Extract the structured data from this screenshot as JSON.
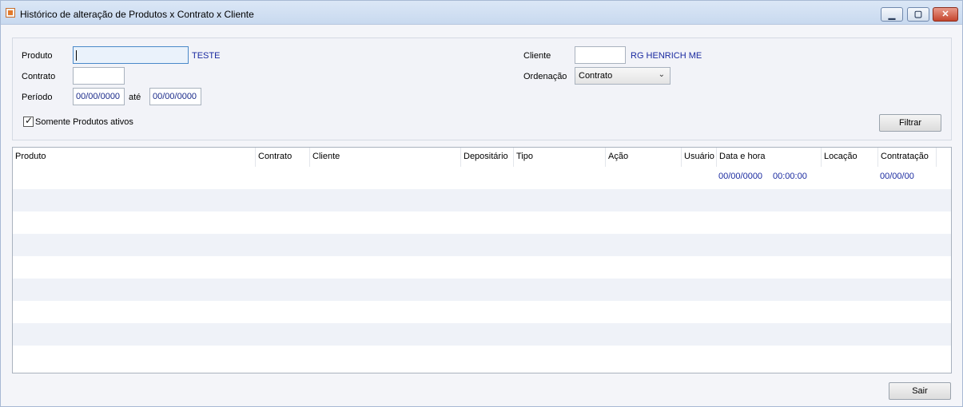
{
  "window": {
    "title": "Histórico de alteração de Produtos x Contrato x Cliente",
    "minimize_glyph": "▁",
    "maximize_glyph": "▢",
    "close_glyph": "✕"
  },
  "filters": {
    "produto_label": "Produto",
    "produto_value": "",
    "produto_desc": "TESTE",
    "contrato_label": "Contrato",
    "contrato_value": "",
    "periodo_label": "Período",
    "periodo_from": "00/00/0000",
    "periodo_ate": "até",
    "periodo_to": "00/00/0000",
    "somente_ativos_label": "Somente Produtos ativos",
    "somente_ativos_checked": true,
    "cliente_label": "Cliente",
    "cliente_value": "",
    "cliente_desc": "RG HENRICH ME",
    "ordenacao_label": "Ordenação",
    "ordenacao_value": "Contrato",
    "filtrar_label": "Filtrar"
  },
  "grid": {
    "columns": [
      "Produto",
      "Contrato",
      "Cliente",
      "Depositário",
      "Tipo",
      "Ação",
      "Usuário",
      "Data e hora",
      "Locação",
      "Contratação"
    ],
    "rows": [
      {
        "data": "00/00/0000",
        "hora": "00:00:00",
        "contratacao": "00/00/00"
      }
    ]
  },
  "footer": {
    "sair_label": "Sair"
  }
}
